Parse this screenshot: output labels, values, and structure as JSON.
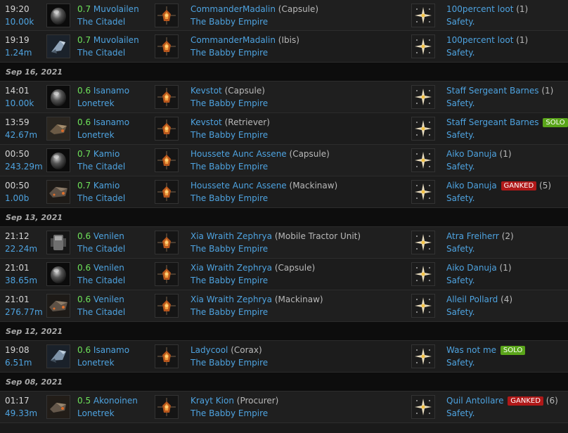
{
  "rows": [
    {
      "type": "kill",
      "time": "19:20",
      "value": "10.00k",
      "sec": "0.7",
      "system": "Muvolailen",
      "region": "The Citadel",
      "ship_icon": "capsule-icon",
      "pilot": "CommanderMadalin",
      "ship": "(Capsule)",
      "corp": "The Babby Empire",
      "final": "100percent loot",
      "badge": "",
      "count": "(1)",
      "alliance": "Safety."
    },
    {
      "type": "kill",
      "time": "19:19",
      "value": "1.24m",
      "sec": "0.7",
      "system": "Muvolailen",
      "region": "The Citadel",
      "ship_icon": "ibis-icon",
      "pilot": "CommanderMadalin",
      "ship": "(Ibis)",
      "corp": "The Babby Empire",
      "final": "100percent loot",
      "badge": "",
      "count": "(1)",
      "alliance": "Safety."
    },
    {
      "type": "date",
      "label": "Sep 16, 2021"
    },
    {
      "type": "kill",
      "time": "14:01",
      "value": "10.00k",
      "sec": "0.6",
      "system": "Isanamo",
      "region": "Lonetrek",
      "ship_icon": "capsule-icon",
      "pilot": "Kevstot",
      "ship": "(Capsule)",
      "corp": "The Babby Empire",
      "final": "Staff Sergeant Barnes",
      "badge": "",
      "count": "(1)",
      "alliance": "Safety."
    },
    {
      "type": "kill",
      "time": "13:59",
      "value": "42.67m",
      "sec": "0.6",
      "system": "Isanamo",
      "region": "Lonetrek",
      "ship_icon": "retriever-icon",
      "pilot": "Kevstot",
      "ship": "(Retriever)",
      "corp": "The Babby Empire",
      "final": "Staff Sergeant Barnes",
      "badge": "SOLO",
      "count": "",
      "alliance": "Safety."
    },
    {
      "type": "kill",
      "time": "00:50",
      "value": "243.29m",
      "sec": "0.7",
      "system": "Kamio",
      "region": "The Citadel",
      "ship_icon": "capsule-icon",
      "pilot": "Houssete Aunc Assene",
      "ship": "(Capsule)",
      "corp": "The Babby Empire",
      "final": "Aiko Danuja",
      "badge": "",
      "count": "(1)",
      "alliance": "Safety."
    },
    {
      "type": "kill",
      "time": "00:50",
      "value": "1.00b",
      "sec": "0.7",
      "system": "Kamio",
      "region": "The Citadel",
      "ship_icon": "mackinaw-icon",
      "pilot": "Houssete Aunc Assene",
      "ship": "(Mackinaw)",
      "corp": "The Babby Empire",
      "final": "Aiko Danuja",
      "badge": "GANKED",
      "count": "(5)",
      "alliance": "Safety."
    },
    {
      "type": "date",
      "label": "Sep 13, 2021"
    },
    {
      "type": "kill",
      "time": "21:12",
      "value": "22.24m",
      "sec": "0.6",
      "system": "Venilen",
      "region": "The Citadel",
      "ship_icon": "mobile-tractor-unit-icon",
      "pilot": "Xia Wraith Zephrya",
      "ship": "(Mobile Tractor Unit)",
      "corp": "The Babby Empire",
      "final": "Atra Freiherr",
      "badge": "",
      "count": "(2)",
      "alliance": "Safety."
    },
    {
      "type": "kill",
      "time": "21:01",
      "value": "38.65m",
      "sec": "0.6",
      "system": "Venilen",
      "region": "The Citadel",
      "ship_icon": "capsule-icon",
      "pilot": "Xia Wraith Zephrya",
      "ship": "(Capsule)",
      "corp": "The Babby Empire",
      "final": "Aiko Danuja",
      "badge": "",
      "count": "(1)",
      "alliance": "Safety."
    },
    {
      "type": "kill",
      "time": "21:01",
      "value": "276.77m",
      "sec": "0.6",
      "system": "Venilen",
      "region": "The Citadel",
      "ship_icon": "mackinaw-icon",
      "pilot": "Xia Wraith Zephrya",
      "ship": "(Mackinaw)",
      "corp": "The Babby Empire",
      "final": "Alleil Pollard",
      "badge": "",
      "count": "(4)",
      "alliance": "Safety."
    },
    {
      "type": "date",
      "label": "Sep 12, 2021"
    },
    {
      "type": "kill",
      "time": "19:08",
      "value": "6.51m",
      "sec": "0.6",
      "system": "Isanamo",
      "region": "Lonetrek",
      "ship_icon": "corax-icon",
      "pilot": "Ladycool",
      "ship": "(Corax)",
      "corp": "The Babby Empire",
      "final": "Was not me",
      "badge": "SOLO",
      "count": "",
      "alliance": "Safety."
    },
    {
      "type": "date",
      "label": "Sep 08, 2021"
    },
    {
      "type": "kill",
      "time": "01:17",
      "value": "49.33m",
      "sec": "0.5",
      "system": "Akonoinen",
      "region": "Lonetrek",
      "ship_icon": "procurer-icon",
      "pilot": "Krayt Kion",
      "ship": "(Procurer)",
      "corp": "The Babby Empire",
      "final": "Quil Antollare",
      "badge": "GANKED",
      "count": "(6)",
      "alliance": "Safety."
    }
  ],
  "colors": {
    "link": "#4ea3e0",
    "security_high": "#6ee35a",
    "solo_badge": "#5aa51a",
    "ganked_badge": "#b01818"
  }
}
